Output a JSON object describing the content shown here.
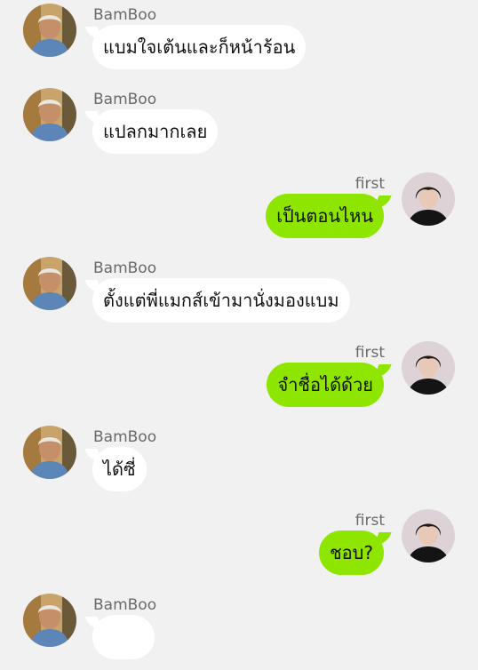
{
  "colors": {
    "background": "#f1f1f1",
    "incoming_bubble": "#ffffff",
    "outgoing_bubble": "#8ee500",
    "name_text": "#6a6a6a"
  },
  "messages": [
    {
      "sender": "BamBoo",
      "direction": "incoming",
      "text": "แบมใจเต้นและก็หน้าร้อน"
    },
    {
      "sender": "BamBoo",
      "direction": "incoming",
      "text": "แปลกมากเลย"
    },
    {
      "sender": "first",
      "direction": "outgoing",
      "text": "เป็นตอนไหน"
    },
    {
      "sender": "BamBoo",
      "direction": "incoming",
      "text": "ตั้งแต่พี่แมกส์เข้ามานั่งมองแบม"
    },
    {
      "sender": "first",
      "direction": "outgoing",
      "text": "จำชื่อได้ด้วย"
    },
    {
      "sender": "BamBoo",
      "direction": "incoming",
      "text": "ได้ซี่"
    },
    {
      "sender": "first",
      "direction": "outgoing",
      "text": "ชอบ?"
    },
    {
      "sender": "BamBoo",
      "direction": "incoming",
      "text": ""
    }
  ]
}
